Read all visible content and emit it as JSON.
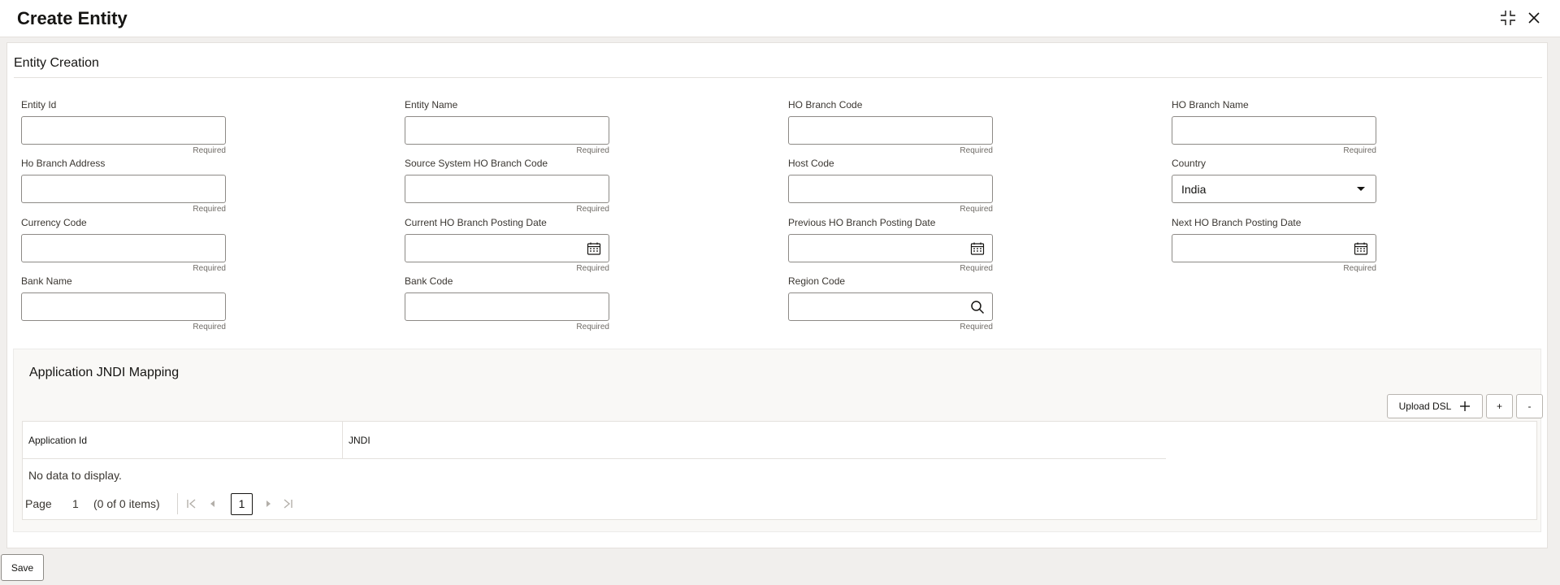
{
  "header": {
    "title": "Create Entity"
  },
  "section": {
    "title": "Entity Creation"
  },
  "fields": {
    "entity_id": {
      "label": "Entity Id",
      "value": "",
      "hint": "Required"
    },
    "entity_name": {
      "label": "Entity Name",
      "value": "",
      "hint": "Required"
    },
    "ho_branch_code": {
      "label": "HO Branch Code",
      "value": "",
      "hint": "Required"
    },
    "ho_branch_name": {
      "label": "HO Branch Name",
      "value": "",
      "hint": "Required"
    },
    "ho_branch_address": {
      "label": "Ho Branch Address",
      "value": "",
      "hint": "Required"
    },
    "source_system_ho_branch_code": {
      "label": "Source System HO Branch Code",
      "value": "",
      "hint": "Required"
    },
    "host_code": {
      "label": "Host Code",
      "value": "",
      "hint": "Required"
    },
    "country": {
      "label": "Country",
      "value": "India"
    },
    "currency_code": {
      "label": "Currency Code",
      "value": "",
      "hint": "Required"
    },
    "current_ho_branch_posting_date": {
      "label": "Current HO Branch Posting Date",
      "value": "",
      "hint": "Required"
    },
    "previous_ho_branch_posting_date": {
      "label": "Previous HO Branch Posting Date",
      "value": "",
      "hint": "Required"
    },
    "next_ho_branch_posting_date": {
      "label": "Next HO Branch Posting Date",
      "value": "",
      "hint": "Required"
    },
    "bank_name": {
      "label": "Bank Name",
      "value": "",
      "hint": "Required"
    },
    "bank_code": {
      "label": "Bank Code",
      "value": "",
      "hint": "Required"
    },
    "region_code": {
      "label": "Region Code",
      "value": "",
      "hint": "Required"
    }
  },
  "jndi": {
    "title": "Application JNDI Mapping",
    "upload_label": "Upload DSL",
    "add_label": "+",
    "remove_label": "-",
    "columns": [
      "Application Id",
      "JNDI"
    ],
    "empty_text": "No data to display.",
    "pager": {
      "page_label": "Page",
      "page_number": "1",
      "items_text": "(0 of 0 items)",
      "current_page": "1"
    }
  },
  "footer": {
    "save_label": "Save"
  },
  "colors": {
    "accent": "#161513",
    "border": "#8d8a86",
    "background": "#f1efed"
  }
}
